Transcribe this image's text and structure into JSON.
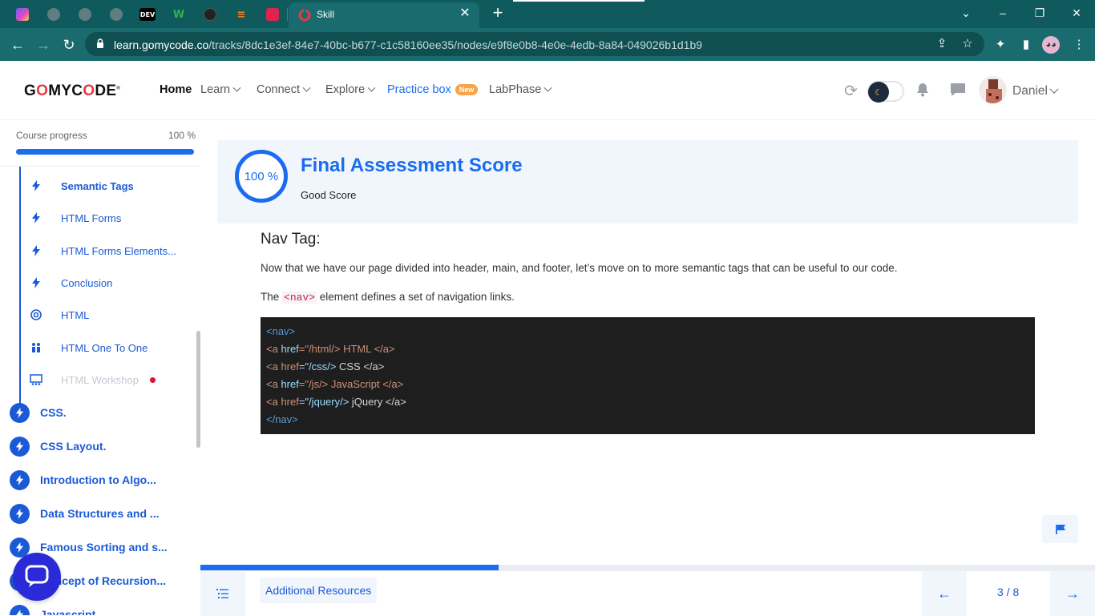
{
  "browser": {
    "active_tab_title": "Skill",
    "url_host": "learn.gomycode.co",
    "url_path": "/tracks/8dc1e3ef-84e7-40bc-b677-c1c58160ee35/nodes/e9f8e0b8-4e0e-4edb-8a84-049026b1d1b9",
    "pinned_tabs": [
      {
        "icon": "colored-square-icon",
        "label": ""
      },
      {
        "icon": "globe-icon",
        "label": ""
      },
      {
        "icon": "globe-icon",
        "label": ""
      },
      {
        "icon": "globe-icon",
        "label": ""
      },
      {
        "icon": "dev-icon",
        "label": "DEV"
      },
      {
        "icon": "w-icon",
        "label": "W"
      },
      {
        "icon": "github-icon",
        "label": ""
      },
      {
        "icon": "stack-icon",
        "label": ""
      },
      {
        "icon": "nest-icon",
        "label": ""
      }
    ]
  },
  "header": {
    "logo": "GOMYCODE",
    "nav": {
      "home": "Home",
      "learn": "Learn",
      "connect": "Connect",
      "explore": "Explore",
      "practice": "Practice box",
      "practice_badge": "New",
      "labphase": "LabPhase"
    },
    "username": "Daniel"
  },
  "sidebar": {
    "progress_label": "Course progress",
    "progress_value": "100 %",
    "progress_fraction": 1.0,
    "lessons": [
      {
        "label": "Semantic Tags",
        "icon": "bolt-icon",
        "state": "active"
      },
      {
        "label": "HTML Forms",
        "icon": "bolt-icon",
        "state": "normal"
      },
      {
        "label": "HTML Forms Elements...",
        "icon": "bolt-icon",
        "state": "normal"
      },
      {
        "label": "Conclusion",
        "icon": "bolt-icon",
        "state": "normal"
      },
      {
        "label": "HTML",
        "icon": "target-icon",
        "state": "normal"
      },
      {
        "label": "HTML One To One",
        "icon": "people-icon",
        "state": "normal"
      },
      {
        "label": "HTML Workshop",
        "icon": "workshop-icon",
        "state": "dim"
      }
    ],
    "courses": [
      "CSS.",
      "CSS Layout.",
      "Introduction to Algo...",
      "Data Structures and ...",
      "Famous Sorting and s...",
      "Concept of Recursion...",
      "Javascript"
    ]
  },
  "main": {
    "score": {
      "value": "100 %",
      "title": "Final Assessment Score",
      "subtitle": "Good Score"
    },
    "heading": "Nav Tag:",
    "paragraph1": "Now that we have our page divided into header, main, and footer, let’s move on to more semantic tags that can be useful to our code.",
    "paragraph2_before": "The ",
    "paragraph2_code": "<nav>",
    "paragraph2_after": " element defines a set of navigation links.",
    "code": {
      "line1": "<nav>",
      "line2_tag": "<a",
      "line2_attr": "href",
      "line2_str": "=\"/html/>",
      "line2_txt": " HTML </a>",
      "line3_tag": "<a",
      "line3_attr": "href",
      "line3_str": "=\"/css/>",
      "line3_txt": " CSS </a>",
      "line4_tag": "<a",
      "line4_attr": "href",
      "line4_str": "=\"/js/>",
      "line4_txt": " JavaScript </a>",
      "line5_tag": "<a",
      "line5_attr": "href",
      "line5_str": "=\"/jquery/>",
      "line5_txt": " jQuery </a>",
      "line6": "</nav>"
    }
  },
  "footer": {
    "resources": "Additional Resources",
    "page": "3 / 8",
    "step_progress_fraction": 0.333
  },
  "colors": {
    "accent": "#1a6cf0",
    "browser_frame": "#0e5a5d",
    "code_bg": "#1e1e1e"
  }
}
